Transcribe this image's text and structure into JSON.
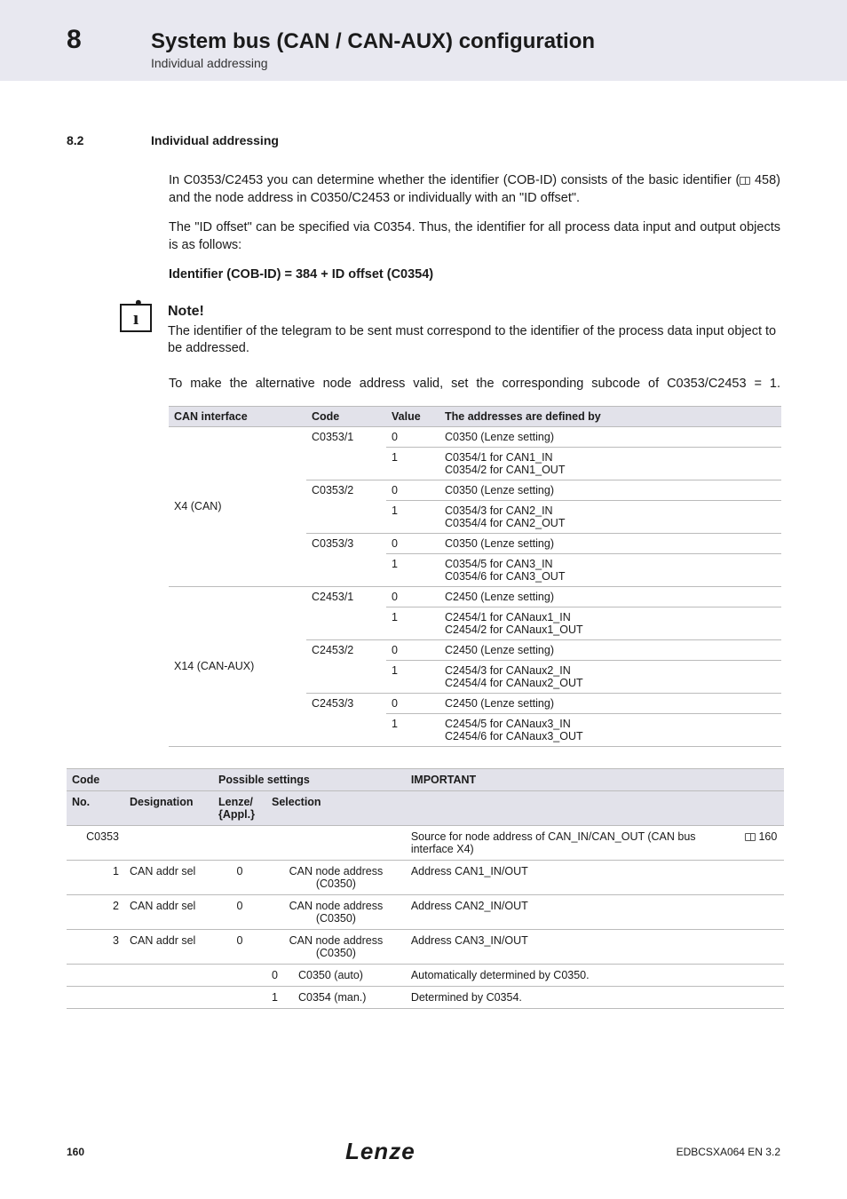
{
  "header": {
    "chapter_number": "8",
    "chapter_title": "System bus (CAN / CAN-AUX) configuration",
    "chapter_sub": "Individual addressing"
  },
  "section": {
    "number": "8.2",
    "title": "Individual addressing"
  },
  "paragraphs": {
    "p1": "In C0353/C2453 you can determine whether the identifier (COB-ID) consists of the basic identifier (",
    "p1_ref": " 458) and the node address in C0350/C2453 or individually with an \"ID offset\".",
    "p2": "The \"ID offset\" can be specified via C0354. Thus, the identifier for all process data input and output objects is as follows:",
    "p3": "Identifier (COB-ID) = 384 + ID offset (C0354)"
  },
  "note": {
    "heading": "Note!",
    "body": "The identifier of the telegram to be sent must correspond to the identifier of the process data input object to be addressed."
  },
  "paragraphs2": {
    "p4": "To make the alternative node address valid, set the corresponding subcode of C0353/C2453 = 1."
  },
  "table1": {
    "head": {
      "c1": "CAN interface",
      "c2": "Code",
      "c3": "Value",
      "c4": "The addresses are defined by"
    },
    "groups": [
      {
        "iface": "X4 (CAN)",
        "codes": [
          {
            "code": "C0353/1",
            "rows": [
              {
                "v": "0",
                "d": "C0350 (Lenze setting)"
              },
              {
                "v": "1",
                "d": "C0354/1 for CAN1_IN\nC0354/2 for CAN1_OUT"
              }
            ]
          },
          {
            "code": "C0353/2",
            "rows": [
              {
                "v": "0",
                "d": "C0350 (Lenze setting)"
              },
              {
                "v": "1",
                "d": "C0354/3 for CAN2_IN\nC0354/4 for CAN2_OUT"
              }
            ]
          },
          {
            "code": "C0353/3",
            "rows": [
              {
                "v": "0",
                "d": "C0350 (Lenze setting)"
              },
              {
                "v": "1",
                "d": "C0354/5 for CAN3_IN\nC0354/6 for CAN3_OUT"
              }
            ]
          }
        ]
      },
      {
        "iface": "X14 (CAN-AUX)",
        "codes": [
          {
            "code": "C2453/1",
            "rows": [
              {
                "v": "0",
                "d": "C2450 (Lenze setting)"
              },
              {
                "v": "1",
                "d": "C2454/1 for CANaux1_IN\nC2454/2 for CANaux1_OUT"
              }
            ]
          },
          {
            "code": "C2453/2",
            "rows": [
              {
                "v": "0",
                "d": "C2450 (Lenze setting)"
              },
              {
                "v": "1",
                "d": "C2454/3 for CANaux2_IN\nC2454/4 for CANaux2_OUT"
              }
            ]
          },
          {
            "code": "C2453/3",
            "rows": [
              {
                "v": "0",
                "d": "C2450 (Lenze setting)"
              },
              {
                "v": "1",
                "d": "C2454/5 for CANaux3_IN\nC2454/6 for CANaux3_OUT"
              }
            ]
          }
        ]
      }
    ]
  },
  "table2": {
    "head1": {
      "code": "Code",
      "possible": "Possible settings",
      "important": "IMPORTANT"
    },
    "head2": {
      "no": "No.",
      "desig": "Designation",
      "lenze": "Lenze/\n{Appl.}",
      "sel": "Selection"
    },
    "rows": [
      {
        "no": "C0353",
        "sub": "",
        "desig": "",
        "lenze": "",
        "sel_k": "",
        "sel_v": "",
        "imp": "Source for node address of CAN_IN/CAN_OUT (CAN bus interface X4)",
        "ref": "160"
      },
      {
        "no": "",
        "sub": "1",
        "desig": "CAN addr sel",
        "lenze": "0",
        "sel_k": "",
        "sel_v": "CAN node address (C0350)",
        "imp": "Address CAN1_IN/OUT",
        "ref": ""
      },
      {
        "no": "",
        "sub": "2",
        "desig": "CAN addr sel",
        "lenze": "0",
        "sel_k": "",
        "sel_v": "CAN node address (C0350)",
        "imp": "Address CAN2_IN/OUT",
        "ref": ""
      },
      {
        "no": "",
        "sub": "3",
        "desig": "CAN addr sel",
        "lenze": "0",
        "sel_k": "",
        "sel_v": "CAN node address (C0350)",
        "imp": "Address CAN3_IN/OUT",
        "ref": ""
      },
      {
        "no": "",
        "sub": "",
        "desig": "",
        "lenze": "",
        "sel_k": "0",
        "sel_v": "C0350 (auto)",
        "imp": "Automatically determined by C0350.",
        "ref": ""
      },
      {
        "no": "",
        "sub": "",
        "desig": "",
        "lenze": "",
        "sel_k": "1",
        "sel_v": "C0354 (man.)",
        "imp": "Determined by C0354.",
        "ref": ""
      }
    ]
  },
  "footer": {
    "page": "160",
    "brand": "Lenze",
    "doc": "EDBCSXA064 EN 3.2"
  }
}
